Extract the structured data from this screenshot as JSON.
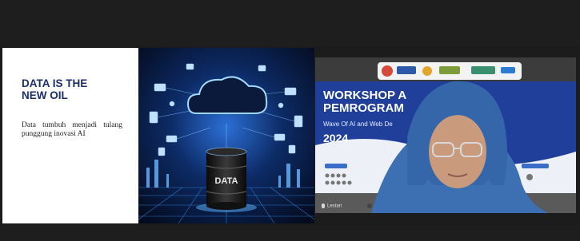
{
  "slide": {
    "title": "DATA IS THE\nNEW OIL",
    "body": "Data tumbuh menjadi tulang punggung inovasi AI",
    "barrel_label": "DATA"
  },
  "video": {
    "banner_line1": "WORKSHOP A",
    "banner_line2": "PEMROGRAM",
    "banner_subtitle": "Wave Of AI and Web De",
    "banner_year": "2024",
    "participant_name": "Lestari"
  },
  "colors": {
    "slide_title": "#1b2d6b",
    "banner_bg": "#1f3f9a",
    "banner_text": "#ffffff",
    "hijab": "#3d6fb3",
    "call_background": "#1c1c1c"
  }
}
